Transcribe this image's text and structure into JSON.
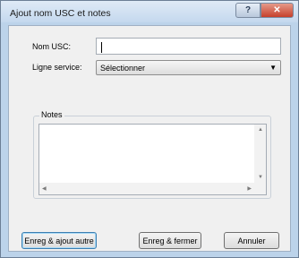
{
  "window": {
    "title": "Ajout nom USC et notes",
    "help_glyph": "?",
    "close_glyph": "✕"
  },
  "form": {
    "nom_label": "Nom USC:",
    "nom_value": "",
    "ligne_label": "Ligne service:",
    "ligne_selected": "Sélectionner",
    "dropdown_glyph": "▼"
  },
  "notes": {
    "legend": "Notes",
    "value": ""
  },
  "buttons": {
    "save_add": "Enreg & ajout autre",
    "save_close": "Enreg & fermer",
    "cancel": "Annuler"
  }
}
